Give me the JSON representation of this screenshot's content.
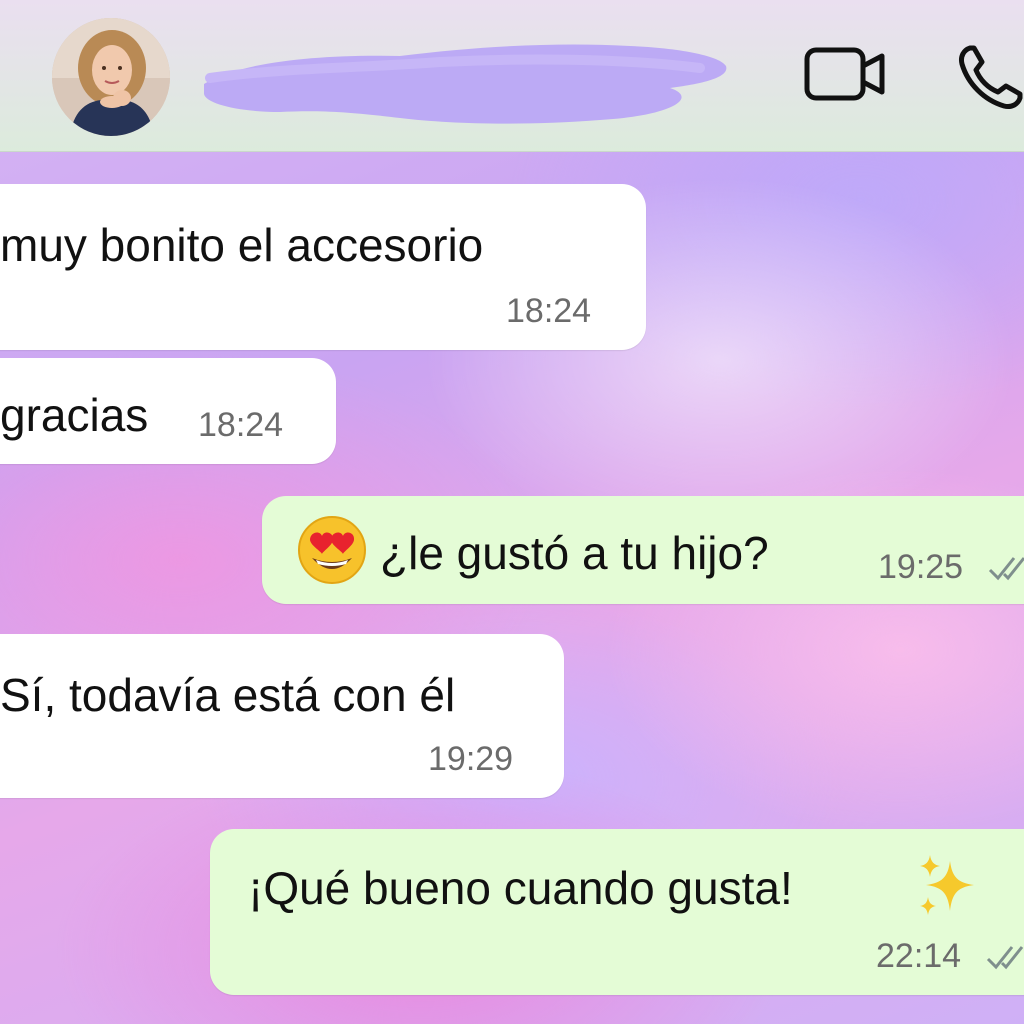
{
  "header": {
    "contact_name": "",
    "avatar": "contact-photo",
    "video_call_icon": "video-camera-icon",
    "voice_call_icon": "phone-icon"
  },
  "colors": {
    "incoming_bubble": "#ffffff",
    "outgoing_bubble": "#e4fcd6",
    "timestamp": "#6b6b6b",
    "header_bg": "#e2ebdf"
  },
  "messages": [
    {
      "direction": "incoming",
      "text": "muy bonito el accesorio",
      "time": "18:24"
    },
    {
      "direction": "incoming",
      "text": "gracias",
      "time": "18:24"
    },
    {
      "direction": "outgoing",
      "emoji": "😍",
      "text": "¿le gustó a tu hijo?",
      "time": "19:25",
      "status": "read-ticks"
    },
    {
      "direction": "incoming",
      "text": "Sí, todavía está con él",
      "time": "19:29"
    },
    {
      "direction": "outgoing",
      "text": "¡Qué bueno cuando gusta!",
      "emoji": "✨",
      "time": "22:14",
      "status": "read-ticks"
    }
  ]
}
